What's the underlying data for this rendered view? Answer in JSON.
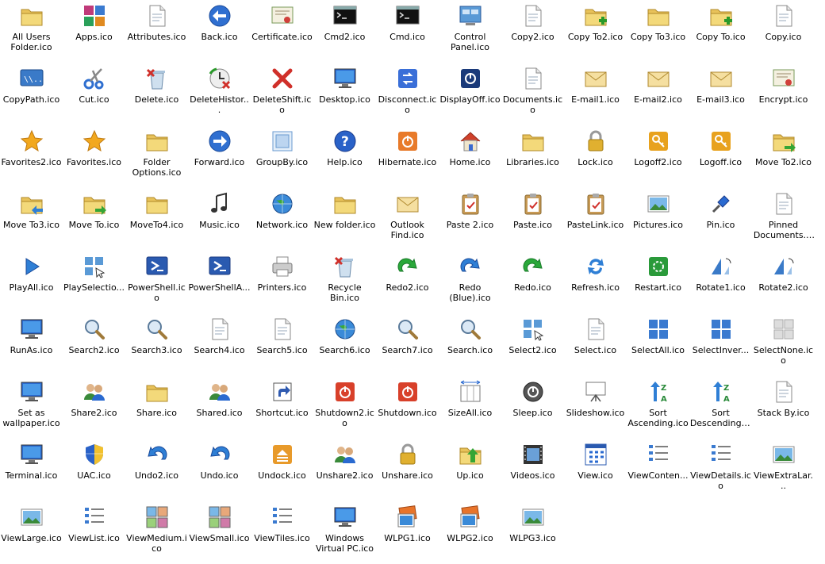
{
  "items": [
    {
      "label": "All Users Folder.ico",
      "icon": "folder-users-icon",
      "k": "folder"
    },
    {
      "label": "Apps.ico",
      "icon": "apps-tiles-icon",
      "k": "tiles"
    },
    {
      "label": "Attributes.ico",
      "icon": "attributes-icon",
      "k": "doc"
    },
    {
      "label": "Back.ico",
      "icon": "back-arrow-icon",
      "k": "back"
    },
    {
      "label": "Certificate.ico",
      "icon": "certificate-icon",
      "k": "cert"
    },
    {
      "label": "Cmd2.ico",
      "icon": "cmd-shield-icon",
      "k": "cmd"
    },
    {
      "label": "Cmd.ico",
      "icon": "cmd-icon",
      "k": "cmd"
    },
    {
      "label": "Control Panel.ico",
      "icon": "control-panel-icon",
      "k": "panel"
    },
    {
      "label": "Copy2.ico",
      "icon": "copy-docs-icon",
      "k": "doc"
    },
    {
      "label": "Copy To2.ico",
      "icon": "copy-to-folder-icon",
      "k": "folderplus"
    },
    {
      "label": "Copy To3.ico",
      "icon": "copy-to-folder-icon",
      "k": "folder"
    },
    {
      "label": "Copy To.ico",
      "icon": "copy-to-folder-icon",
      "k": "folderplus"
    },
    {
      "label": "Copy.ico",
      "icon": "copy-doc-icon",
      "k": "doc"
    },
    {
      "label": "CopyPath.ico",
      "icon": "copy-path-icon",
      "k": "path"
    },
    {
      "label": "Cut.ico",
      "icon": "scissors-icon",
      "k": "scissors"
    },
    {
      "label": "Delete.ico",
      "icon": "delete-icon",
      "k": "bin"
    },
    {
      "label": "DeleteHistor...",
      "icon": "delete-history-icon",
      "k": "history"
    },
    {
      "label": "DeleteShift.ico",
      "icon": "red-x-icon",
      "k": "x"
    },
    {
      "label": "Desktop.ico",
      "icon": "desktop-icon",
      "k": "monitor"
    },
    {
      "label": "Disconnect.ico",
      "icon": "disconnect-icon",
      "k": "bluesq"
    },
    {
      "label": "DisplayOff.ico",
      "icon": "display-off-icon",
      "k": "darksq"
    },
    {
      "label": "Documents.ico",
      "icon": "documents-icon",
      "k": "doc"
    },
    {
      "label": "E-mail1.ico",
      "icon": "envelope-icon",
      "k": "mail"
    },
    {
      "label": "E-mail2.ico",
      "icon": "envelope-open-icon",
      "k": "mail"
    },
    {
      "label": "E-mail3.ico",
      "icon": "envelope-doc-icon",
      "k": "mail"
    },
    {
      "label": "Encrypt.ico",
      "icon": "encrypt-icon",
      "k": "cert"
    },
    {
      "label": "Favorites2.ico",
      "icon": "star-icon",
      "k": "star"
    },
    {
      "label": "Favorites.ico",
      "icon": "star-icon",
      "k": "star"
    },
    {
      "label": "Folder Options.ico",
      "icon": "folder-options-icon",
      "k": "folder"
    },
    {
      "label": "Forward.ico",
      "icon": "forward-arrow-icon",
      "k": "fwd"
    },
    {
      "label": "GroupBy.ico",
      "icon": "group-by-icon",
      "k": "group"
    },
    {
      "label": "Help.ico",
      "icon": "help-icon",
      "k": "help"
    },
    {
      "label": "Hibernate.ico",
      "icon": "hibernate-icon",
      "k": "power"
    },
    {
      "label": "Home.ico",
      "icon": "home-icon",
      "k": "home"
    },
    {
      "label": "Libraries.ico",
      "icon": "libraries-icon",
      "k": "folder"
    },
    {
      "label": "Lock.ico",
      "icon": "lock-icon",
      "k": "lock"
    },
    {
      "label": "Logoff2.ico",
      "icon": "logoff-key-icon",
      "k": "key"
    },
    {
      "label": "Logoff.ico",
      "icon": "logoff-key-icon",
      "k": "key"
    },
    {
      "label": "Move To2.ico",
      "icon": "move-to-folder-icon",
      "k": "foldermove"
    },
    {
      "label": "Move To3.ico",
      "icon": "move-to-folder-icon",
      "k": "folderback"
    },
    {
      "label": "Move To.ico",
      "icon": "move-to-folder-icon",
      "k": "foldermove"
    },
    {
      "label": "MoveTo4.ico",
      "icon": "move-to-folder-icon",
      "k": "folder"
    },
    {
      "label": "Music.ico",
      "icon": "music-note-icon",
      "k": "music"
    },
    {
      "label": "Network.ico",
      "icon": "network-icon",
      "k": "globe"
    },
    {
      "label": "New folder.ico",
      "icon": "new-folder-icon",
      "k": "folder"
    },
    {
      "label": "Outlook Find.ico",
      "icon": "outlook-find-icon",
      "k": "mail"
    },
    {
      "label": "Paste 2.ico",
      "icon": "paste-check-icon",
      "k": "clip"
    },
    {
      "label": "Paste.ico",
      "icon": "paste-icon",
      "k": "clip"
    },
    {
      "label": "PasteLink.ico",
      "icon": "paste-link-icon",
      "k": "clip"
    },
    {
      "label": "Pictures.ico",
      "icon": "pictures-icon",
      "k": "pic"
    },
    {
      "label": "Pin.ico",
      "icon": "pin-icon",
      "k": "pin"
    },
    {
      "label": "Pinned Documents.ico",
      "icon": "pinned-doc-icon",
      "k": "doc"
    },
    {
      "label": "PlayAll.ico",
      "icon": "play-icon",
      "k": "play"
    },
    {
      "label": "PlaySelectio...",
      "icon": "play-selection-icon",
      "k": "select"
    },
    {
      "label": "PowerShell.ico",
      "icon": "powershell-icon",
      "k": "ps"
    },
    {
      "label": "PowerShellA...",
      "icon": "powershell-admin-icon",
      "k": "ps"
    },
    {
      "label": "Printers.ico",
      "icon": "printer-icon",
      "k": "printer"
    },
    {
      "label": "Recycle Bin.ico",
      "icon": "recycle-bin-icon",
      "k": "bin"
    },
    {
      "label": "Redo2.ico",
      "icon": "redo-green-icon",
      "k": "redo"
    },
    {
      "label": "Redo (Blue).ico",
      "icon": "redo-blue-icon",
      "k": "redob"
    },
    {
      "label": "Redo.ico",
      "icon": "redo-green-icon",
      "k": "redo"
    },
    {
      "label": "Refresh.ico",
      "icon": "refresh-icon",
      "k": "refresh"
    },
    {
      "label": "Restart.ico",
      "icon": "restart-icon",
      "k": "restart"
    },
    {
      "label": "Rotate1.ico",
      "icon": "rotate-left-icon",
      "k": "rotate"
    },
    {
      "label": "Rotate2.ico",
      "icon": "rotate-right-icon",
      "k": "rotate"
    },
    {
      "label": "RunAs.ico",
      "icon": "run-as-icon",
      "k": "monitor"
    },
    {
      "label": "Search2.ico",
      "icon": "magnifier-icon",
      "k": "search"
    },
    {
      "label": "Search3.ico",
      "icon": "magnifier-icon",
      "k": "search"
    },
    {
      "label": "Search4.ico",
      "icon": "search-doc-icon",
      "k": "doc"
    },
    {
      "label": "Search5.ico",
      "icon": "search-doc-icon",
      "k": "doc"
    },
    {
      "label": "Search6.ico",
      "icon": "search-globe-icon",
      "k": "globe"
    },
    {
      "label": "Search7.ico",
      "icon": "magnifier-icon",
      "k": "search"
    },
    {
      "label": "Search.ico",
      "icon": "magnifier-icon",
      "k": "search"
    },
    {
      "label": "Select2.ico",
      "icon": "select-cursor-icon",
      "k": "select"
    },
    {
      "label": "Select.ico",
      "icon": "select-doc-icon",
      "k": "doc"
    },
    {
      "label": "SelectAll.ico",
      "icon": "select-all-icon",
      "k": "grid4"
    },
    {
      "label": "SelectInver...",
      "icon": "select-invert-icon",
      "k": "grid4"
    },
    {
      "label": "SelectNone.ico",
      "icon": "select-none-icon",
      "k": "grid4g"
    },
    {
      "label": "Set as wallpaper.ico",
      "icon": "wallpaper-icon",
      "k": "monitor"
    },
    {
      "label": "Share2.ico",
      "icon": "share-users-icon",
      "k": "users"
    },
    {
      "label": "Share.ico",
      "icon": "share-folder-icon",
      "k": "folder"
    },
    {
      "label": "Shared.ico",
      "icon": "shared-icon",
      "k": "users"
    },
    {
      "label": "Shortcut.ico",
      "icon": "shortcut-icon",
      "k": "shortcut"
    },
    {
      "label": "Shutdown2.ico",
      "icon": "shutdown-icon",
      "k": "powerred"
    },
    {
      "label": "Shutdown.ico",
      "icon": "shutdown-icon",
      "k": "powerred"
    },
    {
      "label": "SizeAll.ico",
      "icon": "size-all-icon",
      "k": "sizeall"
    },
    {
      "label": "Sleep.ico",
      "icon": "sleep-icon",
      "k": "sleep"
    },
    {
      "label": "Slideshow.ico",
      "icon": "slideshow-icon",
      "k": "slideshow"
    },
    {
      "label": "Sort Ascending.ico",
      "icon": "sort-ascending-icon",
      "k": "sort"
    },
    {
      "label": "Sort Descending.ico",
      "icon": "sort-descending-icon",
      "k": "sort"
    },
    {
      "label": "Stack By.ico",
      "icon": "stack-by-icon",
      "k": "doc"
    },
    {
      "label": "Terminal.ico",
      "icon": "terminal-icon",
      "k": "monitor"
    },
    {
      "label": "UAC.ico",
      "icon": "uac-shield-icon",
      "k": "shield"
    },
    {
      "label": "Undo2.ico",
      "icon": "undo-icon",
      "k": "undo"
    },
    {
      "label": "Undo.ico",
      "icon": "undo-icon",
      "k": "undo"
    },
    {
      "label": "Undock.ico",
      "icon": "undock-icon",
      "k": "undock"
    },
    {
      "label": "Unshare2.ico",
      "icon": "unshare-users-icon",
      "k": "users"
    },
    {
      "label": "Unshare.ico",
      "icon": "unshare-lock-icon",
      "k": "lock"
    },
    {
      "label": "Up.ico",
      "icon": "up-folder-icon",
      "k": "folderup"
    },
    {
      "label": "Videos.ico",
      "icon": "videos-icon",
      "k": "film"
    },
    {
      "label": "View.ico",
      "icon": "view-icon",
      "k": "view"
    },
    {
      "label": "ViewConten...",
      "icon": "view-content-icon",
      "k": "list"
    },
    {
      "label": "ViewDetails.ico",
      "icon": "view-details-icon",
      "k": "list"
    },
    {
      "label": "ViewExtraLar...",
      "icon": "view-extra-large-icon",
      "k": "pic"
    },
    {
      "label": "ViewLarge.ico",
      "icon": "view-large-icon",
      "k": "pic"
    },
    {
      "label": "ViewList.ico",
      "icon": "view-list-icon",
      "k": "list"
    },
    {
      "label": "ViewMedium.ico",
      "icon": "view-medium-icon",
      "k": "thumbs"
    },
    {
      "label": "ViewSmall.ico",
      "icon": "view-small-icon",
      "k": "thumbs"
    },
    {
      "label": "ViewTiles.ico",
      "icon": "view-tiles-icon",
      "k": "list"
    },
    {
      "label": "Windows Virtual PC.ico",
      "icon": "virtual-pc-icon",
      "k": "monitor"
    },
    {
      "label": "WLPG1.ico",
      "icon": "photo-gallery-icon",
      "k": "photos"
    },
    {
      "label": "WLPG2.ico",
      "icon": "photo-gallery-icon",
      "k": "photos"
    },
    {
      "label": "WLPG3.ico",
      "icon": "photo-gallery-icon",
      "k": "pic"
    }
  ]
}
